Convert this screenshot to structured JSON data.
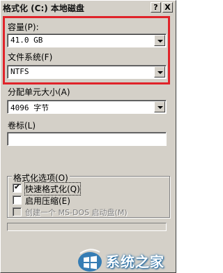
{
  "window": {
    "title": "格式化 (C:) 本地磁盘",
    "help_glyph": "?",
    "close_glyph": "X"
  },
  "capacity": {
    "label": "容量(P):",
    "value": "41.0 GB"
  },
  "filesystem": {
    "label": "文件系统(F)",
    "value": "NTFS"
  },
  "allocation": {
    "label": "分配单元大小(A)",
    "value": "4096 字节"
  },
  "volume_label": {
    "label": "卷标(L)",
    "value": ""
  },
  "format_options": {
    "title": "格式化选项(O)",
    "quick_format": {
      "label": "快速格式化(Q)",
      "checked": true
    },
    "compression": {
      "label": "启用压缩(E)",
      "checked": false
    },
    "msdos_disk": {
      "label": "创建一个 MS-DOS 启动盘(M)",
      "checked": false,
      "enabled": false
    }
  },
  "progress": {
    "percent": 0
  },
  "watermark": {
    "text": "系统之家",
    "icon": "windows-logo-icon"
  },
  "colors": {
    "face": "#d4d0c8",
    "highlight_border": "#e0232a",
    "watermark": "#1a6fb0"
  }
}
